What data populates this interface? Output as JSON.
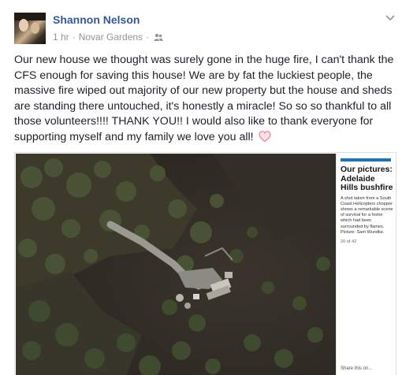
{
  "post": {
    "author": "Shannon Nelson",
    "time": "1 hr",
    "separator": "·",
    "location": "Novar Gardens",
    "privacy_icon": "friends-icon",
    "menu_icon": "chevron-down-icon",
    "text": "Our new house we thought was surely gone in the huge fire, I can't thank the CFS enough for saving this house! We are by fat the luckiest people, the massive fire wiped out majority of our new property but the house and sheds are standing there untouched, it's honestly a miracle! So so so thankful to all those volunteers!!!! THANK YOU!! I would also like to thank everyone for supporting myself and my family we love you all!",
    "emoji": "heart-icon"
  },
  "attachment": {
    "title": "Our pictures: Adelaide Hills bushfire",
    "caption": "A shot taken from a South Coast Helicopters chopper shows a remarkable scene of survival for a home which had been surrounded by flames. Picture: Sam Wundke.",
    "count": "20 of 42",
    "share": "Share this on..."
  },
  "colors": {
    "link": "#365899",
    "meta": "#90949c",
    "text": "#1d2129",
    "accent": "#1a73c7"
  }
}
